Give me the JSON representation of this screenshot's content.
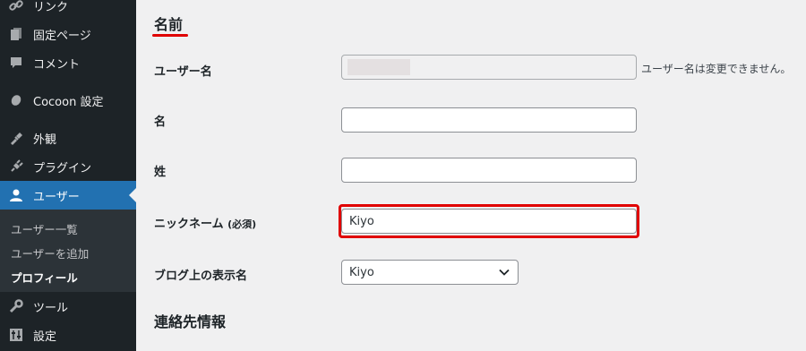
{
  "sidebar": {
    "items": [
      {
        "label": "リンク",
        "icon": "link-icon"
      },
      {
        "label": "固定ページ",
        "icon": "pages-icon"
      },
      {
        "label": "コメント",
        "icon": "comments-icon"
      },
      {
        "label": "Cocoon 設定",
        "icon": "cocoon-icon"
      },
      {
        "label": "外観",
        "icon": "appearance-icon"
      },
      {
        "label": "プラグイン",
        "icon": "plugins-icon"
      },
      {
        "label": "ユーザー",
        "icon": "users-icon",
        "active": true
      },
      {
        "label": "ツール",
        "icon": "tools-icon"
      },
      {
        "label": "設定",
        "icon": "settings-icon"
      }
    ],
    "submenu": [
      {
        "label": "ユーザー一覧"
      },
      {
        "label": "ユーザーを追加"
      },
      {
        "label": "プロフィール",
        "current": true
      }
    ]
  },
  "main": {
    "section_title": "名前",
    "fields": {
      "username": {
        "label": "ユーザー名",
        "hint": "ユーザー名は変更できません。",
        "value": ""
      },
      "first_name": {
        "label": "名",
        "value": ""
      },
      "last_name": {
        "label": "姓",
        "value": ""
      },
      "nickname": {
        "label": "ニックネーム",
        "required": "(必須)",
        "value": "Kiyo"
      },
      "display_name": {
        "label": "ブログ上の表示名",
        "value": "Kiyo"
      }
    },
    "section_title2": "連絡先情報"
  },
  "colors": {
    "sidebar_bg": "#1d2327",
    "active_bg": "#2271b1",
    "highlight": "#e00000",
    "page_bg": "#f0f0f1"
  }
}
